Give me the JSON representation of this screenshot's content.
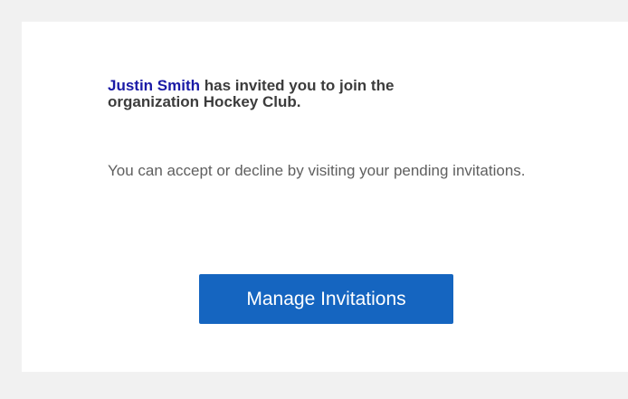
{
  "email": {
    "inviter_name": "Justin Smith",
    "invite_message_part1": " has invited you to join the",
    "invite_message_part2": "organization Hockey Club.",
    "info_message": "You can accept or decline by visiting your pending invitations.",
    "button_label": "Manage Invitations"
  },
  "colors": {
    "inviter": "#1a1aa6",
    "button_background": "#1565c0",
    "background": "#f1f1f1",
    "card": "#ffffff"
  }
}
